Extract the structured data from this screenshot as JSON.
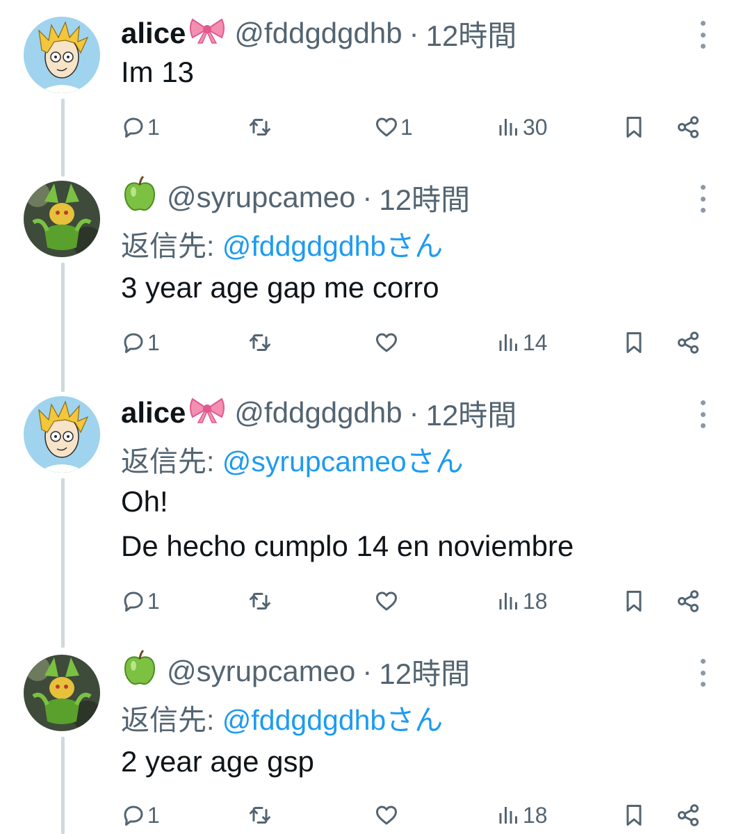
{
  "tweets": [
    {
      "name": "alice",
      "name_emoji": "ribbon-emoji",
      "handle": "@fddgdgdhb",
      "separator": "·",
      "time": "12時間",
      "reply_prefix": "",
      "reply_handle": "",
      "reply_suffix": "",
      "lines": [
        "Im 13"
      ],
      "reply_count": "1",
      "retweet_count": "",
      "like_count": "1",
      "view_count": "30",
      "avatar": "blonde-boy-avatar"
    },
    {
      "name": "",
      "name_emoji": "green-apple-emoji",
      "handle": "@syrupcameo",
      "separator": "·",
      "time": "12時間",
      "reply_prefix": "返信先: ",
      "reply_handle": "@fddgdgdhb",
      "reply_suffix": "さん",
      "lines": [
        "3 year age gap me corro"
      ],
      "reply_count": "1",
      "retweet_count": "",
      "like_count": "",
      "view_count": "14",
      "avatar": "leavanny-avatar"
    },
    {
      "name": "alice",
      "name_emoji": "ribbon-emoji",
      "handle": "@fddgdgdhb",
      "separator": "·",
      "time": "12時間",
      "reply_prefix": "返信先: ",
      "reply_handle": "@syrupcameo",
      "reply_suffix": "さん",
      "lines": [
        "Oh!",
        "De hecho cumplo 14 en noviembre"
      ],
      "reply_count": "1",
      "retweet_count": "",
      "like_count": "",
      "view_count": "18",
      "avatar": "blonde-boy-avatar"
    },
    {
      "name": "",
      "name_emoji": "green-apple-emoji",
      "handle": "@syrupcameo",
      "separator": "·",
      "time": "12時間",
      "reply_prefix": "返信先: ",
      "reply_handle": "@fddgdgdhb",
      "reply_suffix": "さん",
      "lines": [
        "2 year age gsp"
      ],
      "reply_count": "1",
      "retweet_count": "",
      "like_count": "",
      "view_count": "18",
      "avatar": "leavanny-avatar"
    }
  ],
  "colors": {
    "text": "#0f1419",
    "muted": "#536471",
    "link": "#1d9bf0",
    "thread_line": "#cfd9de"
  }
}
